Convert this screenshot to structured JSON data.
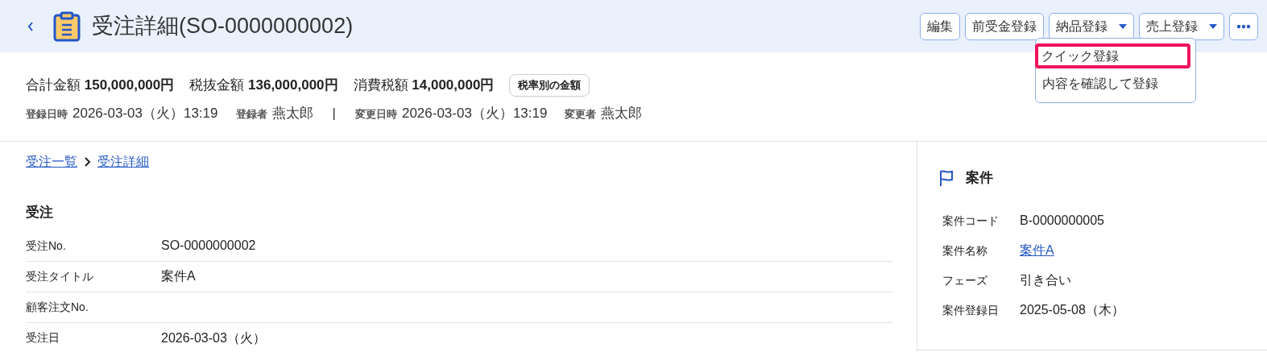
{
  "header": {
    "title": "受注詳細(SO-0000000002)",
    "buttons": [
      {
        "label": "編集",
        "dropdown": false,
        "kind": "text"
      },
      {
        "label": "前受金登録",
        "dropdown": false,
        "kind": "text"
      },
      {
        "label": "納品登録",
        "dropdown": true,
        "kind": "text"
      },
      {
        "label": "売上登録",
        "dropdown": true,
        "kind": "text"
      },
      {
        "kind": "more"
      }
    ],
    "menu": {
      "items": [
        {
          "label": "クイック登録",
          "highlighted": true
        },
        {
          "label": "内容を確認して登録",
          "highlighted": false
        }
      ]
    }
  },
  "summary": {
    "amounts": [
      {
        "label": "合計金額",
        "value": "150,000,000円"
      },
      {
        "label": "税抜金額",
        "value": "136,000,000円"
      },
      {
        "label": "消費税額",
        "value": "14,000,000円"
      }
    ],
    "tax_button": "税率別の金額",
    "meta": [
      {
        "label": "登録日時",
        "value": "2026-03-03（火）13:19"
      },
      {
        "label": "登録者",
        "value": "燕太郎"
      },
      {
        "kind": "separator",
        "value": "|"
      },
      {
        "label": "変更日時",
        "value": "2026-03-03（火）13:19"
      },
      {
        "label": "変更者",
        "value": "燕太郎"
      }
    ]
  },
  "breadcrumb": [
    "受注一覧",
    "受注詳細"
  ],
  "section": {
    "title": "受注",
    "rows": [
      {
        "label": "受注No.",
        "value": "SO-0000000002"
      },
      {
        "label": "受注タイトル",
        "value": "案件A"
      },
      {
        "label": "顧客注文No."
      },
      {
        "label": "受注日",
        "value": "2026-03-03（火）"
      }
    ]
  },
  "side_panel": {
    "title": "案件",
    "rows": [
      {
        "label": "案件コード",
        "value": "B-0000000005",
        "link": false
      },
      {
        "label": "案件名称",
        "value": "案件A",
        "link": true
      },
      {
        "label": "フェーズ",
        "value": "引き合い",
        "link": false
      },
      {
        "label": "案件登録日",
        "value": "2025-05-08（木）",
        "link": false
      }
    ]
  }
}
